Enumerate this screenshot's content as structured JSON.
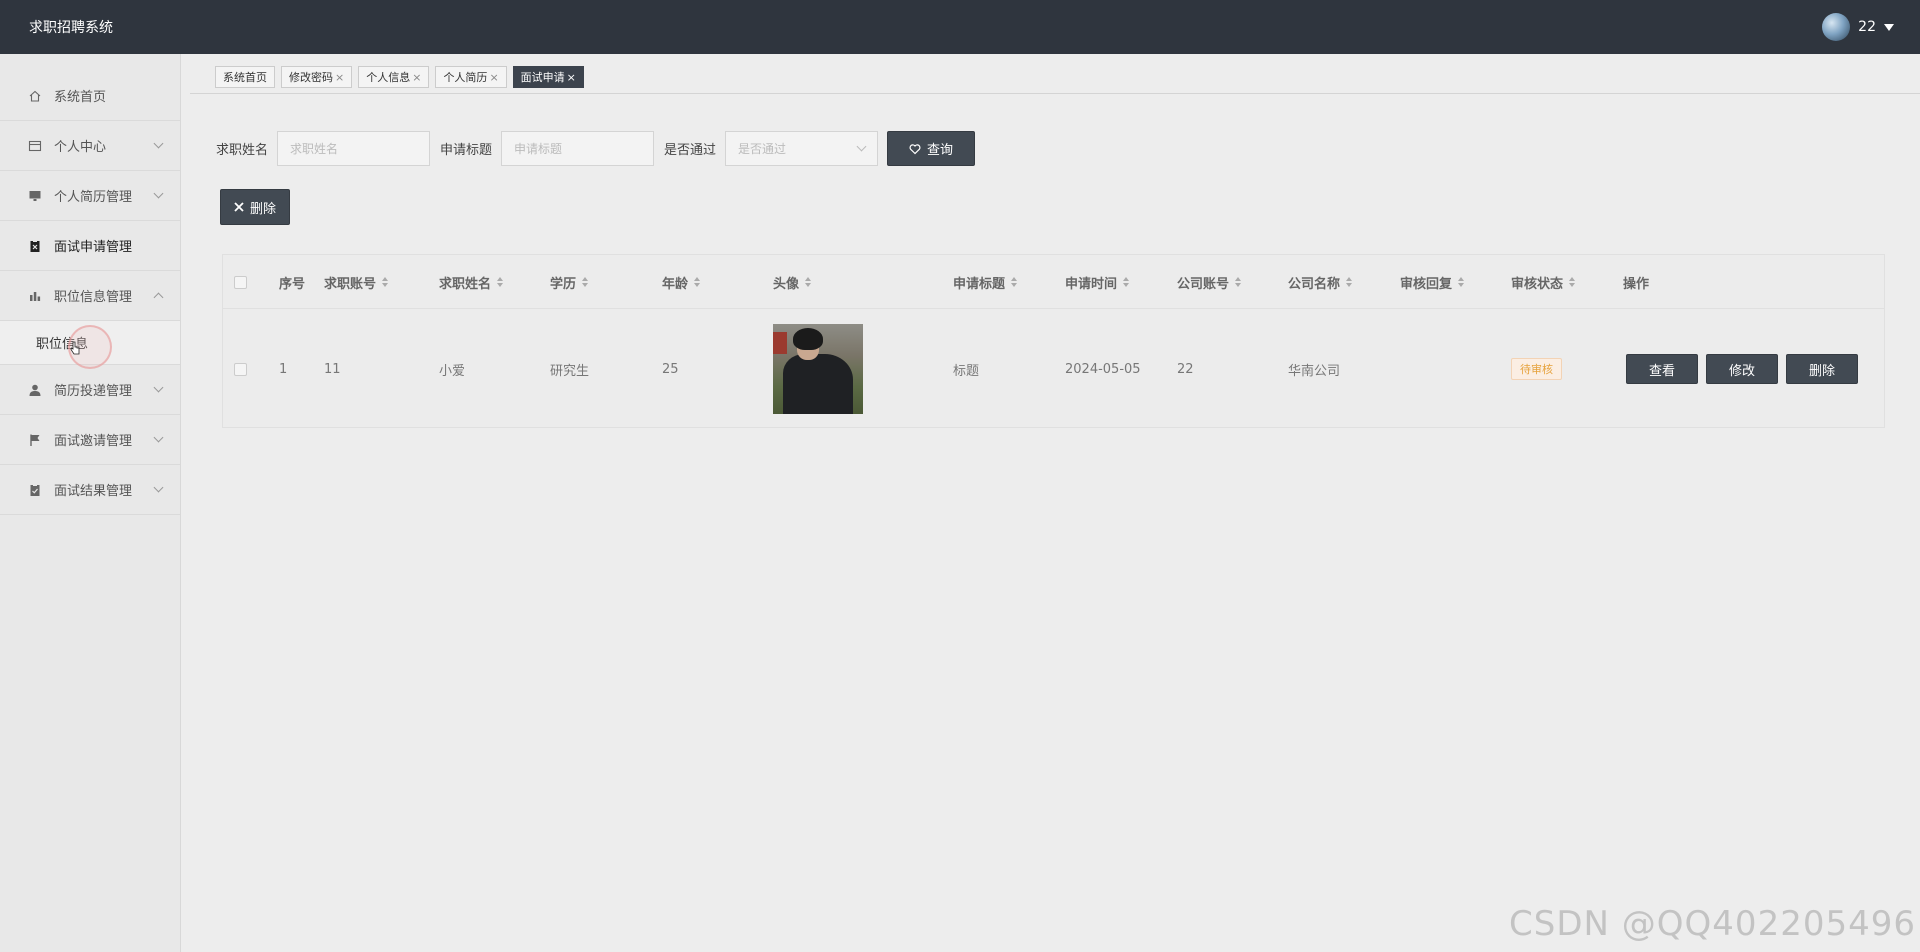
{
  "app": {
    "title": "求职招聘系统"
  },
  "user": {
    "name": "22"
  },
  "sidebar": {
    "items": [
      {
        "label": "系统首页",
        "icon": "home-icon"
      },
      {
        "label": "个人中心",
        "icon": "card-icon"
      },
      {
        "label": "个人简历管理",
        "icon": "monitor-icon"
      },
      {
        "label": "面试申请管理",
        "icon": "clipboard-icon"
      },
      {
        "label": "职位信息管理",
        "icon": "bar-chart-icon"
      },
      {
        "label": "简历投递管理",
        "icon": "user-icon"
      },
      {
        "label": "面试邀请管理",
        "icon": "flag-icon"
      },
      {
        "label": "面试结果管理",
        "icon": "checklist-icon"
      }
    ],
    "submenu": {
      "label": "职位信息"
    }
  },
  "tabs": [
    {
      "label": "系统首页"
    },
    {
      "label": "修改密码"
    },
    {
      "label": "个人信息"
    },
    {
      "label": "个人简历"
    },
    {
      "label": "面试申请"
    }
  ],
  "tab_close_glyph": "×",
  "search": {
    "name_label": "求职姓名",
    "name_placeholder": "求职姓名",
    "title_label": "申请标题",
    "title_placeholder": "申请标题",
    "pass_label": "是否通过",
    "pass_placeholder": "是否通过",
    "query_button": "查询"
  },
  "toolbar": {
    "delete_button": "删除"
  },
  "table": {
    "headers": [
      "序号",
      "求职账号",
      "求职姓名",
      "学历",
      "年龄",
      "头像",
      "申请标题",
      "申请时间",
      "公司账号",
      "公司名称",
      "审核回复",
      "审核状态",
      "操作"
    ],
    "rows": [
      {
        "index": "1",
        "account": "11",
        "name": "小爱",
        "education": "研究生",
        "age": "25",
        "title": "标题",
        "time": "2024-05-05",
        "company_account": "22",
        "company_name": "华南公司",
        "reply": "",
        "status": "待审核",
        "actions": {
          "view": "查看",
          "edit": "修改",
          "delete": "删除"
        }
      }
    ]
  },
  "colors": {
    "topbar": "#2f353e",
    "button": "#424a53",
    "status_badge": "#e6a23c"
  },
  "watermark": "CSDN @QQ402205496"
}
